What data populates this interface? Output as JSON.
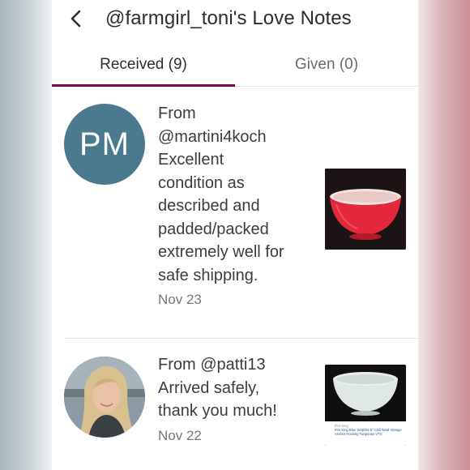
{
  "header": {
    "back_icon": "chevron-left-icon",
    "title": "@farmgirl_toni's Love Notes"
  },
  "tabs": [
    {
      "label": "Received (9)",
      "active": true
    },
    {
      "label": "Given (0)",
      "active": false
    }
  ],
  "accent_color": "#7f0353",
  "notes": [
    {
      "avatar_initials": "PM",
      "avatar_color": "#4b7a8e",
      "from_prefix": "From",
      "from_user": "@martini4koch",
      "message_lines": [
        "Excellent",
        "condition as",
        "described and",
        "padded/packed",
        "extremely well for",
        "safe shipping."
      ],
      "date": "Nov 23",
      "thumbnail": "red-mixing-bowl"
    },
    {
      "avatar": "profile-photo",
      "from_line": "From @patti13",
      "message_lines": [
        "Arrived safely,",
        "thank you much!"
      ],
      "date": "Nov 22",
      "thumbnail": "white-mixing-bowl",
      "thumbnail_brand": "Fire King",
      "thumbnail_caption": "Fire King Blue Delphite 5\" Chili Bowl Vintage Anchor Hocking Turquoise VTG"
    }
  ]
}
